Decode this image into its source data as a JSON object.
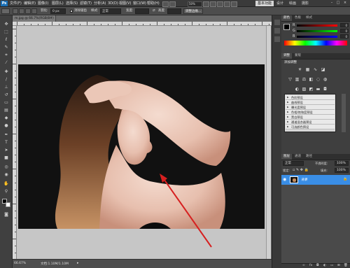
{
  "menubar": {
    "logo": "Ps",
    "items": [
      "文件(F)",
      "编辑(E)",
      "图像(I)",
      "图层(L)",
      "选择(S)",
      "滤镜(T)",
      "分析(A)",
      "3D(D)",
      "视图(V)",
      "窗口(W)",
      "帮助(H)"
    ],
    "zoom": "50%",
    "workspace_active": "基本功能",
    "workspaces": [
      "设计",
      "绘画",
      "摄影"
    ],
    "window_buttons": [
      "–",
      "□",
      "×"
    ]
  },
  "options": {
    "feather_label": "羽化:",
    "feather_value": "0 px",
    "antialias_label": "消除锯齿",
    "style_label": "样式:",
    "style_value": "正常",
    "width_label": "宽度:",
    "height_label": "高度:",
    "refine_edge": "调整边缘..."
  },
  "document": {
    "tab_title": "m.jpg @ 66.7%(RGB/8#)",
    "status_zoom": "66.67%",
    "status_doc": "文档:1.10M/1.10M"
  },
  "color_panel": {
    "tabs": [
      "颜色",
      "色板",
      "样式"
    ],
    "channels": [
      {
        "label": "R",
        "value": "0"
      },
      {
        "label": "G",
        "value": "0"
      },
      {
        "label": "B",
        "value": "0"
      }
    ]
  },
  "adjust_panel": {
    "tabs": [
      "调整",
      "蒙版"
    ],
    "title": "添加调整",
    "presets": [
      "色阶预设",
      "曲线预设",
      "曝光度预设",
      "色相/饱和度预设",
      "黑白预设",
      "通道混合器预设",
      "可选颜色预设"
    ]
  },
  "layers_panel": {
    "tabs": [
      "图层",
      "通道",
      "路径"
    ],
    "blend_mode": "正常",
    "opacity_label": "不透明度:",
    "opacity_value": "100%",
    "lock_label": "锁定:",
    "fill_label": "填充:",
    "fill_value": "100%",
    "layer_name": "背景",
    "footer_icons": [
      "link-icon",
      "fx-icon",
      "mask-icon",
      "adjustment-icon",
      "folder-icon",
      "new-layer-icon",
      "trash-icon"
    ]
  },
  "colors": {
    "accent": "#1a6fb5",
    "selected_layer": "#3a8ee6",
    "arrow": "#d62020",
    "photo_bg": "#111111"
  }
}
